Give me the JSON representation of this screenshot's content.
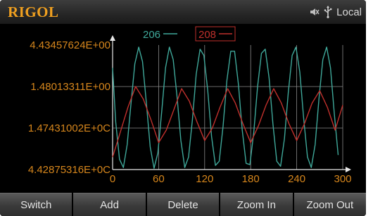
{
  "header": {
    "brand": "RIGOL",
    "status_text": "Local",
    "icons": [
      "speaker-muted-icon",
      "usb-icon"
    ]
  },
  "colors": {
    "accent": "#f0a020",
    "series_206": "#3fa89a",
    "series_208": "#c0302c",
    "grid": "#8a8a8a"
  },
  "chart_data": {
    "type": "line",
    "y_tick_labels": [
      "4.43457624E+00",
      "1.48013311E+00",
      "1.47431002E+0C",
      "4.42875316E+0C"
    ],
    "x_ticks": [
      0,
      60,
      120,
      180,
      240,
      300
    ],
    "xlim": [
      0,
      300
    ],
    "ylim": [
      0,
      3
    ],
    "grid": true,
    "legend_position": "top-center",
    "series": [
      {
        "name": "206",
        "color": "#3fa89a",
        "x": [
          0,
          4,
          9,
          14,
          19,
          24,
          29,
          34,
          39,
          44,
          49,
          54,
          59,
          64,
          69,
          74,
          79,
          84,
          89,
          94,
          99,
          104,
          109,
          114,
          119,
          124,
          129,
          134,
          139,
          144,
          149,
          154,
          159,
          164,
          169,
          174,
          179,
          184,
          189,
          194,
          199,
          204,
          209,
          214,
          219,
          224,
          229,
          234,
          239,
          244,
          249,
          254,
          259,
          264,
          269,
          274,
          279,
          284,
          289,
          294
        ],
        "y": [
          2.45,
          1.15,
          0.25,
          0.05,
          0.6,
          1.6,
          2.55,
          2.95,
          2.6,
          1.6,
          0.55,
          0.03,
          0.4,
          1.4,
          2.45,
          2.95,
          2.65,
          1.75,
          0.7,
          0.05,
          0.3,
          1.2,
          2.3,
          2.9,
          2.75,
          1.9,
          0.8,
          0.1,
          0.2,
          1.05,
          2.15,
          2.85,
          2.85,
          2.05,
          0.95,
          0.15,
          0.12,
          0.9,
          2.0,
          2.8,
          2.9,
          2.2,
          1.1,
          0.2,
          0.08,
          0.75,
          1.85,
          2.75,
          2.95,
          2.35,
          1.25,
          0.3,
          0.05,
          0.6,
          1.7,
          2.65,
          2.95,
          2.45,
          1.35,
          0.35
        ]
      },
      {
        "name": "208",
        "color": "#c0302c",
        "x": [
          0,
          10,
          20,
          30,
          40,
          50,
          60,
          70,
          80,
          90,
          100,
          110,
          120,
          130,
          140,
          150,
          160,
          170,
          180,
          190,
          200,
          210,
          220,
          230,
          240,
          250,
          260,
          270,
          280,
          290,
          300
        ],
        "y": [
          0.3,
          0.9,
          1.5,
          2.0,
          1.7,
          1.2,
          0.65,
          0.95,
          1.45,
          1.95,
          1.65,
          1.15,
          0.7,
          1.0,
          1.5,
          1.95,
          1.6,
          1.1,
          0.65,
          1.05,
          1.55,
          1.95,
          1.6,
          1.1,
          0.7,
          1.1,
          1.6,
          1.9,
          1.5,
          0.95,
          1.55
        ]
      }
    ]
  },
  "softkeys": [
    {
      "label": "Switch"
    },
    {
      "label": "Add"
    },
    {
      "label": "Delete"
    },
    {
      "label": "Zoom In"
    },
    {
      "label": "Zoom Out"
    }
  ]
}
